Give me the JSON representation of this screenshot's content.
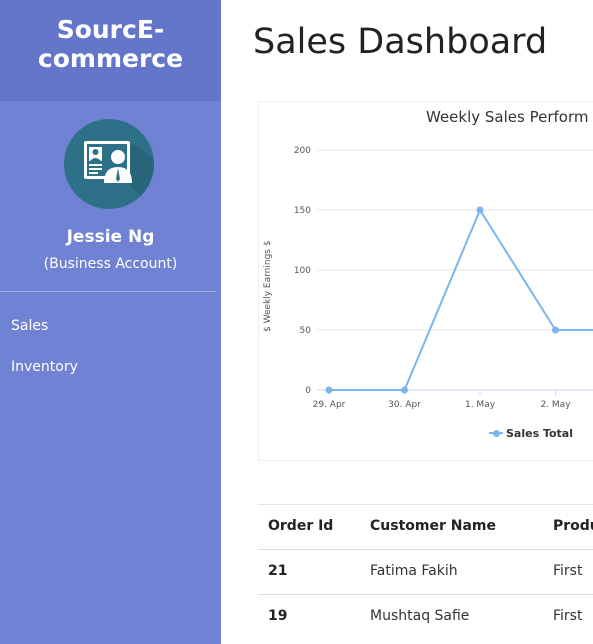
{
  "brand": {
    "line1": "SourcE-",
    "line2": "commerce"
  },
  "user": {
    "name": "Jessie Ng",
    "role": "(Business Account)"
  },
  "nav": {
    "items": [
      {
        "label": "Sales"
      },
      {
        "label": "Inventory"
      }
    ]
  },
  "page": {
    "title": "Sales Dashboard"
  },
  "chart_data": {
    "type": "line",
    "title": "Weekly Sales Perform",
    "ylabel": "$ Weekly Earnings $",
    "xlabel": "",
    "categories": [
      "29. Apr",
      "30. Apr",
      "1. May",
      "2. May"
    ],
    "series": [
      {
        "name": "Sales Total",
        "values": [
          0,
          0,
          150,
          50
        ],
        "color": "#7cb5ec"
      }
    ],
    "ylim": [
      0,
      200
    ],
    "yticks": [
      0,
      50,
      100,
      150,
      200
    ],
    "grid": true,
    "legend": "bottom-center"
  },
  "table": {
    "headers": [
      "Order Id",
      "Customer Name",
      "Produ"
    ],
    "rows": [
      [
        "21",
        "Fatima Fakih",
        "First"
      ],
      [
        "19",
        "Mushtaq Safie",
        "First"
      ]
    ]
  },
  "colors": {
    "sidebar": "#7082d3",
    "brand_bar": "#6476c9",
    "avatar_bg": "#2d7088",
    "series": "#7cb5ec"
  },
  "icons": {
    "avatar": "business-card-user-icon",
    "legend": "legend-marker-icon"
  }
}
